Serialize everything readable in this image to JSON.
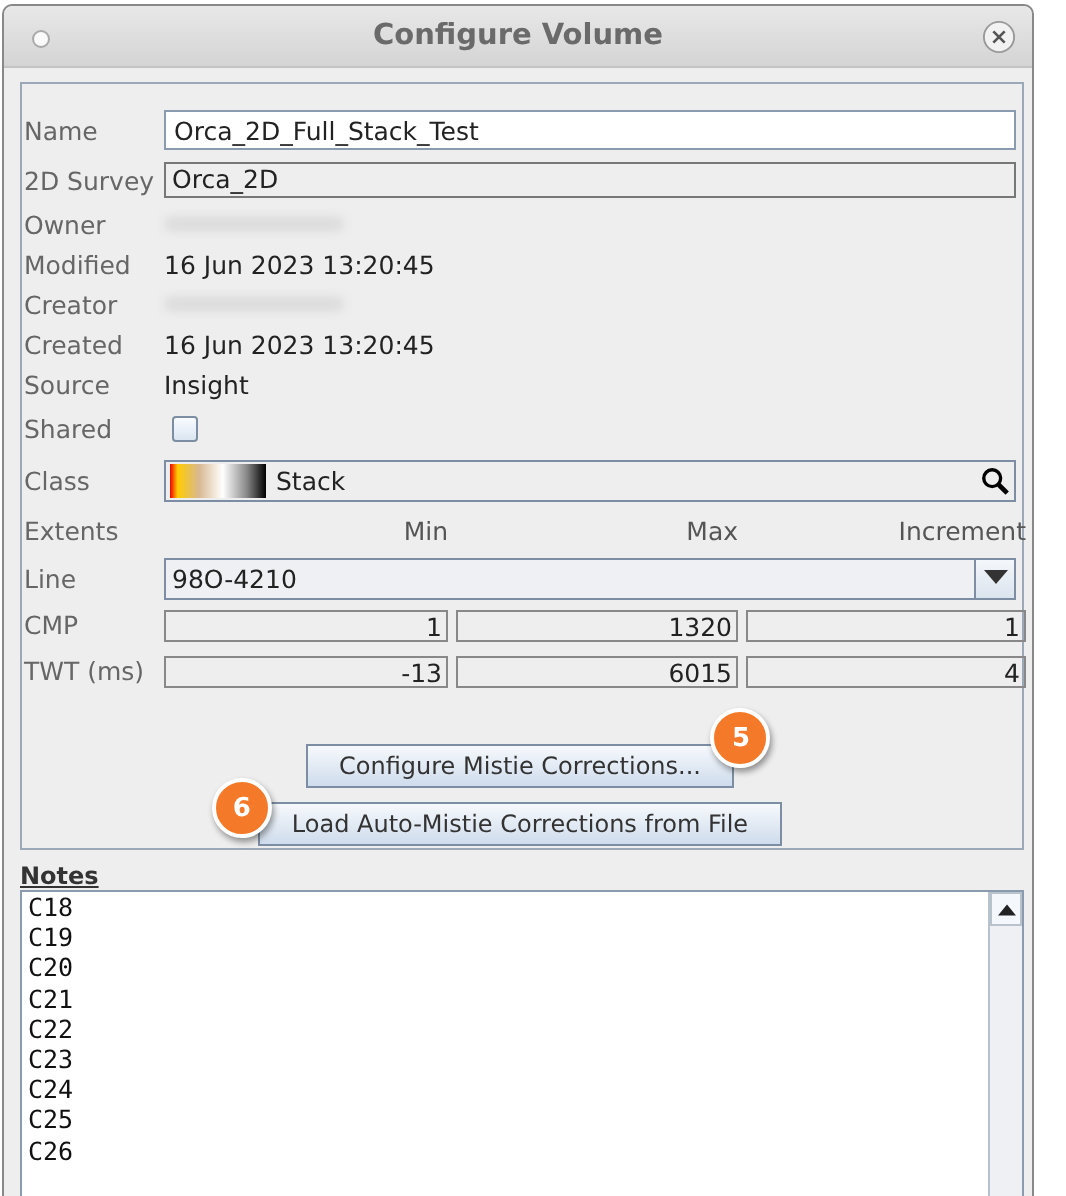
{
  "window": {
    "title": "Configure Volume"
  },
  "fields": [
    {
      "kind": "text",
      "label": "Name",
      "value": "Orca_2D_Full_Stack_Test"
    },
    {
      "kind": "readonly",
      "label": "2D Survey",
      "value": "Orca_2D"
    },
    {
      "kind": "redacted",
      "label": "Owner"
    },
    {
      "kind": "plain",
      "label": "Modified",
      "value": "16 Jun 2023 13:20:45"
    },
    {
      "kind": "redacted",
      "label": "Creator"
    },
    {
      "kind": "plain",
      "label": "Created",
      "value": "16 Jun 2023 13:20:45"
    },
    {
      "kind": "plain",
      "label": "Source",
      "value": "Insight"
    },
    {
      "kind": "checkbox",
      "label": "Shared",
      "checked": false
    },
    {
      "kind": "class",
      "label": "Class",
      "value": "Stack"
    },
    {
      "kind": "header",
      "label": "Extents",
      "columns": [
        "Min",
        "Max",
        "Increment"
      ]
    },
    {
      "kind": "dropdown",
      "label": "Line",
      "value": "98O-4210"
    },
    {
      "kind": "triple",
      "label": "CMP",
      "values": [
        "1",
        "1320",
        "1"
      ]
    },
    {
      "kind": "triple",
      "label": "TWT (ms)",
      "values": [
        "-13",
        "6015",
        "4"
      ]
    }
  ],
  "buttons": [
    {
      "label": "Configure Mistie Corrections...",
      "badge": "5",
      "kind": "trailing"
    },
    {
      "label": "Load Auto-Mistie Corrections from File",
      "badge": "6",
      "kind": "leading"
    }
  ],
  "notes": {
    "title": "Notes",
    "lines": [
      "C18",
      "C19",
      "C20",
      "C21",
      "C22",
      "C23",
      "C24",
      "C25",
      "C26"
    ]
  }
}
